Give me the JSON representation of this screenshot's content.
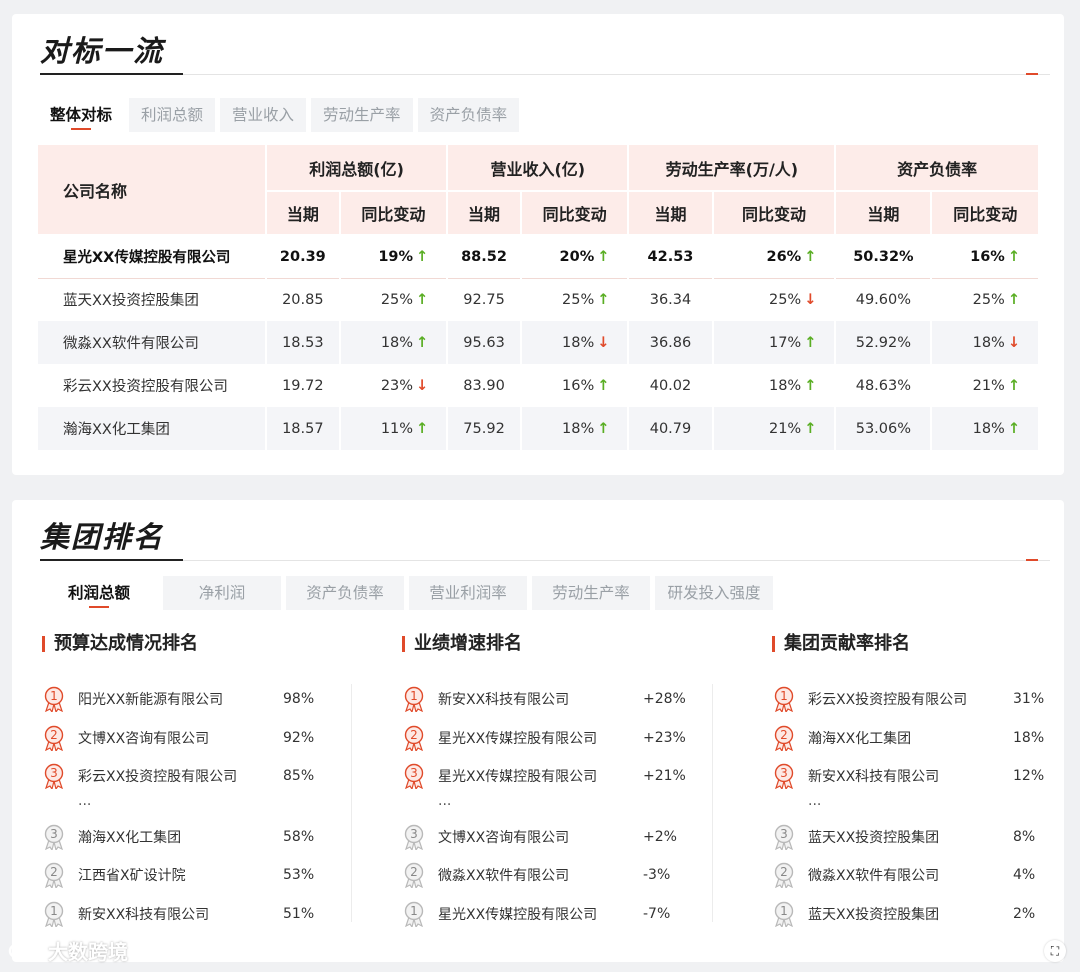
{
  "benchmark": {
    "title": "对标一流",
    "tabs": [
      {
        "label": "整体对标",
        "active": true
      },
      {
        "label": "利润总额",
        "active": false
      },
      {
        "label": "营业收入",
        "active": false
      },
      {
        "label": "劳动生产率",
        "active": false
      },
      {
        "label": "资产负债率",
        "active": false
      }
    ],
    "table": {
      "company_header": "公司名称",
      "groups": [
        "利润总额(亿)",
        "营业收入(亿)",
        "劳动生产率(万/人)",
        "资产负债率"
      ],
      "sub_current": "当期",
      "sub_change": "同比变动",
      "rows": [
        {
          "company": "星光XX传媒控股有限公司",
          "v": [
            "20.39",
            "88.52",
            "42.53",
            "50.32%"
          ],
          "c": [
            "19%",
            "20%",
            "26%",
            "16%"
          ],
          "d": [
            "up",
            "up",
            "up",
            "up"
          ]
        },
        {
          "company": "蓝天XX投资控股集团",
          "v": [
            "20.85",
            "92.75",
            "36.34",
            "49.60%"
          ],
          "c": [
            "25%",
            "25%",
            "25%",
            "25%"
          ],
          "d": [
            "up",
            "up",
            "down",
            "up"
          ]
        },
        {
          "company": "微淼XX软件有限公司",
          "v": [
            "18.53",
            "95.63",
            "36.86",
            "52.92%"
          ],
          "c": [
            "18%",
            "18%",
            "17%",
            "18%"
          ],
          "d": [
            "up",
            "down",
            "up",
            "down"
          ]
        },
        {
          "company": "彩云XX投资控股有限公司",
          "v": [
            "19.72",
            "83.90",
            "40.02",
            "48.63%"
          ],
          "c": [
            "23%",
            "16%",
            "18%",
            "21%"
          ],
          "d": [
            "down",
            "up",
            "up",
            "up"
          ]
        },
        {
          "company": "瀚海XX化工集团",
          "v": [
            "18.57",
            "75.92",
            "40.79",
            "53.06%"
          ],
          "c": [
            "11%",
            "18%",
            "21%",
            "18%"
          ],
          "d": [
            "up",
            "up",
            "up",
            "up"
          ]
        }
      ]
    }
  },
  "ranking": {
    "title": "集团排名",
    "tabs": [
      {
        "label": "利润总额",
        "active": true
      },
      {
        "label": "净利润",
        "active": false
      },
      {
        "label": "资产负债率",
        "active": false
      },
      {
        "label": "营业利润率",
        "active": false
      },
      {
        "label": "劳动生产率",
        "active": false
      },
      {
        "label": "研发投入强度",
        "active": false
      }
    ],
    "ellipsis": "...",
    "columns": [
      {
        "title": "预算达成情况排名",
        "top": [
          {
            "rank": "1",
            "name": "阳光XX新能源有限公司",
            "value": "98%"
          },
          {
            "rank": "2",
            "name": "文博XX咨询有限公司",
            "value": "92%"
          },
          {
            "rank": "3",
            "name": "彩云XX投资控股有限公司",
            "value": "85%"
          }
        ],
        "bottom": [
          {
            "rank": "3",
            "name": "瀚海XX化工集团",
            "value": "58%"
          },
          {
            "rank": "2",
            "name": "江西省X矿设计院",
            "value": "53%"
          },
          {
            "rank": "1",
            "name": "新安XX科技有限公司",
            "value": "51%"
          }
        ]
      },
      {
        "title": "业绩增速排名",
        "top": [
          {
            "rank": "1",
            "name": "新安XX科技有限公司",
            "value": "+28%"
          },
          {
            "rank": "2",
            "name": "星光XX传媒控股有限公司",
            "value": "+23%"
          },
          {
            "rank": "3",
            "name": "星光XX传媒控股有限公司",
            "value": "+21%"
          }
        ],
        "bottom": [
          {
            "rank": "3",
            "name": "文博XX咨询有限公司",
            "value": "+2%"
          },
          {
            "rank": "2",
            "name": "微淼XX软件有限公司",
            "value": "-3%"
          },
          {
            "rank": "1",
            "name": "星光XX传媒控股有限公司",
            "value": "-7%"
          }
        ]
      },
      {
        "title": "集团贡献率排名",
        "top": [
          {
            "rank": "1",
            "name": "彩云XX投资控股有限公司",
            "value": "31%"
          },
          {
            "rank": "2",
            "name": "瀚海XX化工集团",
            "value": "18%"
          },
          {
            "rank": "3",
            "name": "新安XX科技有限公司",
            "value": "12%"
          }
        ],
        "bottom": [
          {
            "rank": "3",
            "name": "蓝天XX投资控股集团",
            "value": "8%"
          },
          {
            "rank": "2",
            "name": "微淼XX软件有限公司",
            "value": "4%"
          },
          {
            "rank": "1",
            "name": "蓝天XX投资控股集团",
            "value": "2%"
          }
        ]
      }
    ]
  },
  "colors": {
    "accent": "#e04a2a",
    "up": "#5aae24",
    "down": "#e04a2a",
    "header_bg": "#fdece9"
  },
  "watermark": {
    "text": "大数跨境"
  },
  "icons": {
    "up": "arrow-up-icon",
    "down": "arrow-down-icon",
    "medal_top": "red-ribbon-medal-icon",
    "medal_bottom": "gray-ribbon-medal-icon",
    "corner": "fullscreen-icon"
  }
}
